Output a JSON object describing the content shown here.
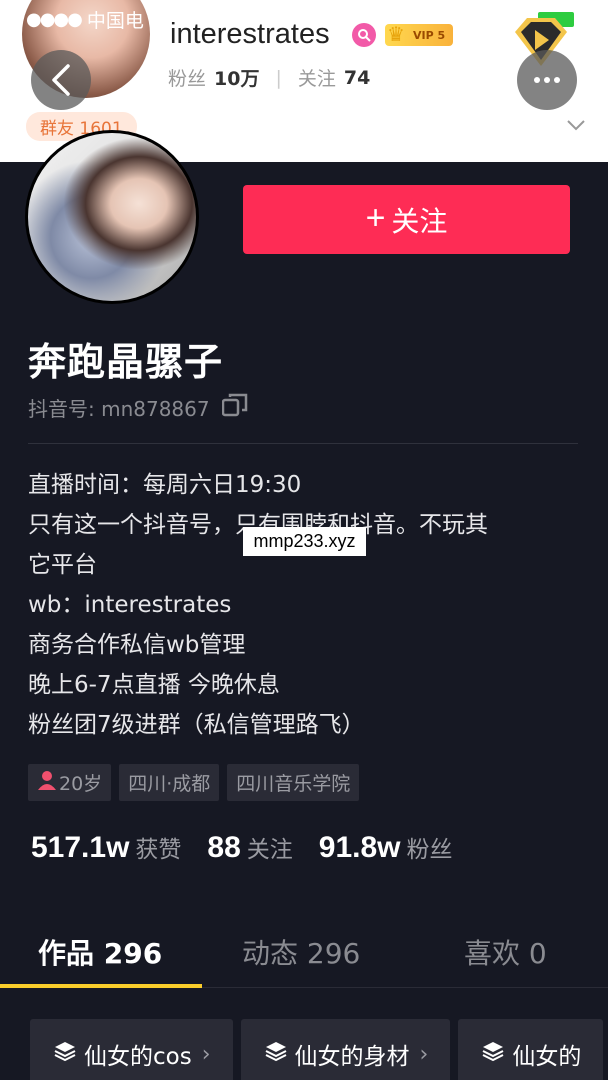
{
  "status_bar": {
    "signal": "●●●●",
    "carrier": "中国电"
  },
  "header": {
    "username": "interestrates",
    "vip_label": "VIP 5",
    "followers_label": "粉丝",
    "followers_value": "10万",
    "following_label": "关注",
    "following_value": "74",
    "group_label": "群友 1601"
  },
  "profile": {
    "follow_label": "关注",
    "nickname": "奔跑晶骡子",
    "douyin_id": "抖音号: mn878867",
    "bio_lines": [
      "直播时间：每周六日19:30",
      "只有这一个抖音号，只有围脖和抖音。不玩其",
      "它平台",
      "wb：interestrates",
      "商务合作私信wb管理",
      "晚上6-7点直播  今晚休息",
      "粉丝团7级进群（私信管理路飞）"
    ],
    "watermark": "mmp233.xyz",
    "tags": [
      "20岁",
      "四川·成都",
      "四川音乐学院"
    ]
  },
  "counts": [
    {
      "value": "517.1w",
      "label": "获赞"
    },
    {
      "value": "88",
      "label": "关注"
    },
    {
      "value": "91.8w",
      "label": "粉丝"
    }
  ],
  "tabs": [
    {
      "label": "作品 296",
      "active": true
    },
    {
      "label": "动态 296",
      "active": false
    },
    {
      "label": "喜欢 0",
      "active": false
    }
  ],
  "collections": [
    "仙女的cos",
    "仙女的身材",
    "仙女的"
  ],
  "colors": {
    "background": "#161823",
    "follow_button": "#fe2c55",
    "tab_underline": "#facd2b"
  }
}
